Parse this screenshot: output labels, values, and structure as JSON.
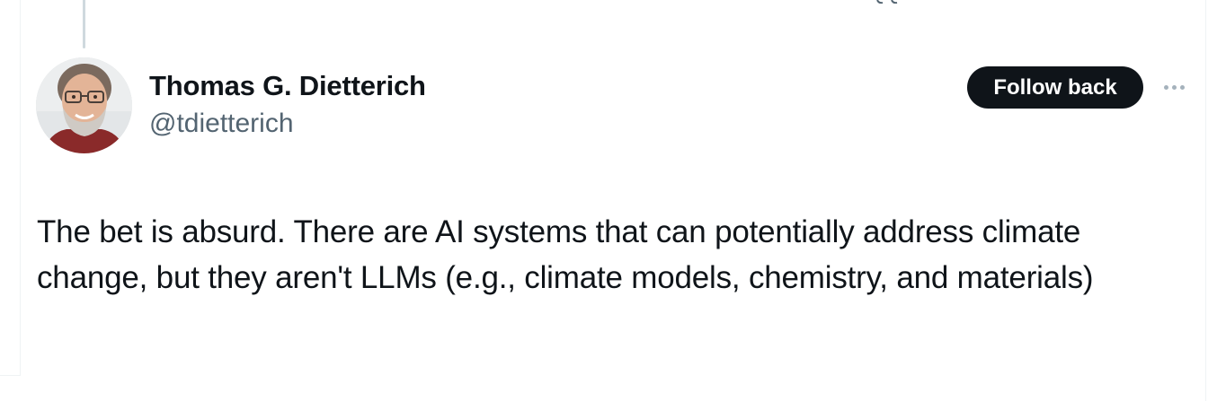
{
  "author": {
    "display_name": "Thomas G. Dietterich",
    "handle": "@tdietterich"
  },
  "actions": {
    "follow_label": "Follow back",
    "more_icon": "more-horizontal-icon"
  },
  "tweet": {
    "text": "The bet is absurd. There are AI systems that can potentially address climate change, but they aren't LLMs (e.g., climate models, chemistry, and materials)"
  },
  "colors": {
    "text_primary": "#0f1419",
    "text_secondary": "#536471",
    "button_bg": "#0f1419",
    "button_text": "#ffffff",
    "thread_line": "#cfd9de",
    "border": "#eff3f4"
  }
}
